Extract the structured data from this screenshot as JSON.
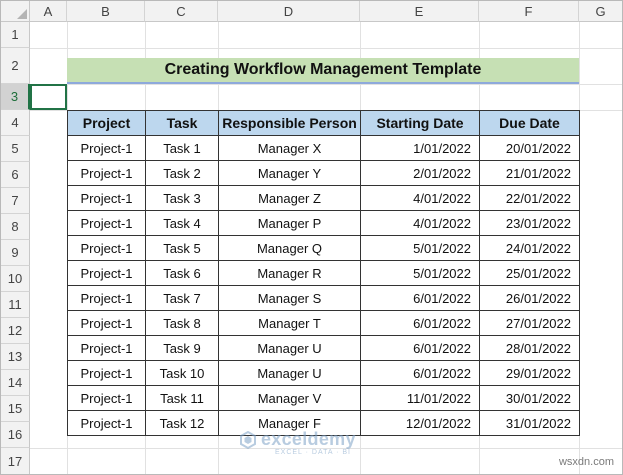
{
  "columns": [
    "A",
    "B",
    "C",
    "D",
    "E",
    "F",
    "G"
  ],
  "rows": [
    "1",
    "2",
    "3",
    "4",
    "5",
    "6",
    "7",
    "8",
    "9",
    "10",
    "11",
    "12",
    "13",
    "14",
    "15",
    "16",
    "17"
  ],
  "active_row": "3",
  "title": "Creating Workflow Management Template",
  "table": {
    "headers": [
      "Project",
      "Task",
      "Responsible Person",
      "Starting Date",
      "Due Date"
    ],
    "rows": [
      [
        "Project-1",
        "Task 1",
        "Manager X",
        "1/01/2022",
        "20/01/2022"
      ],
      [
        "Project-1",
        "Task 2",
        "Manager Y",
        "2/01/2022",
        "21/01/2022"
      ],
      [
        "Project-1",
        "Task 3",
        "Manager Z",
        "4/01/2022",
        "22/01/2022"
      ],
      [
        "Project-1",
        "Task 4",
        "Manager P",
        "4/01/2022",
        "23/01/2022"
      ],
      [
        "Project-1",
        "Task 5",
        "Manager Q",
        "5/01/2022",
        "24/01/2022"
      ],
      [
        "Project-1",
        "Task 6",
        "Manager R",
        "5/01/2022",
        "25/01/2022"
      ],
      [
        "Project-1",
        "Task 7",
        "Manager S",
        "6/01/2022",
        "26/01/2022"
      ],
      [
        "Project-1",
        "Task 8",
        "Manager T",
        "6/01/2022",
        "27/01/2022"
      ],
      [
        "Project-1",
        "Task 9",
        "Manager U",
        "6/01/2022",
        "28/01/2022"
      ],
      [
        "Project-1",
        "Task 10",
        "Manager U",
        "6/01/2022",
        "29/01/2022"
      ],
      [
        "Project-1",
        "Task 11",
        "Manager V",
        "11/01/2022",
        "30/01/2022"
      ],
      [
        "Project-1",
        "Task 12",
        "Manager F",
        "12/01/2022",
        "31/01/2022"
      ]
    ]
  },
  "watermark": {
    "name": "exceldemy",
    "tagline": "EXCEL · DATA · BI"
  },
  "credit": "wsxdn.com",
  "colors": {
    "title_fill": "#c6e0b4",
    "header_fill": "#bdd7ee",
    "selection": "#217346"
  }
}
